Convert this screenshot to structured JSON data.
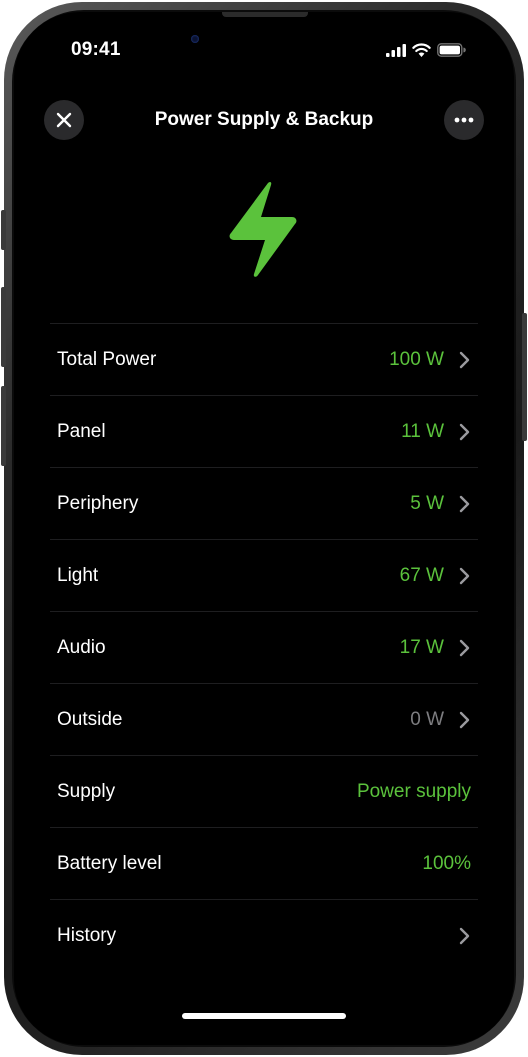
{
  "status_bar": {
    "time": "09:41",
    "signal_icon": "cellular-signal-icon",
    "wifi_icon": "wifi-icon",
    "battery_icon": "battery-icon"
  },
  "header": {
    "title": "Power Supply & Backup",
    "close_icon": "close-icon",
    "more_icon": "more-horizontal-icon"
  },
  "hero": {
    "icon": "lightning-bolt-icon",
    "color": "#5bc23c"
  },
  "colors": {
    "accent_green": "#5bc23c",
    "muted_gray": "#7d7d80",
    "background": "#000000",
    "button_bg": "#2a2a2c"
  },
  "rows": [
    {
      "label": "Total Power",
      "value": "100 W",
      "value_color": "green",
      "chevron": true
    },
    {
      "label": "Panel",
      "value": "11 W",
      "value_color": "green",
      "chevron": true
    },
    {
      "label": "Periphery",
      "value": "5 W",
      "value_color": "green",
      "chevron": true
    },
    {
      "label": "Light",
      "value": "67 W",
      "value_color": "green",
      "chevron": true
    },
    {
      "label": "Audio",
      "value": "17 W",
      "value_color": "green",
      "chevron": true
    },
    {
      "label": "Outside",
      "value": "0 W",
      "value_color": "gray",
      "chevron": true
    },
    {
      "label": "Supply",
      "value": "Power supply",
      "value_color": "green",
      "chevron": false
    },
    {
      "label": "Battery level",
      "value": "100%",
      "value_color": "green",
      "chevron": false
    },
    {
      "label": "History",
      "value": "",
      "value_color": "green",
      "chevron": true
    }
  ]
}
